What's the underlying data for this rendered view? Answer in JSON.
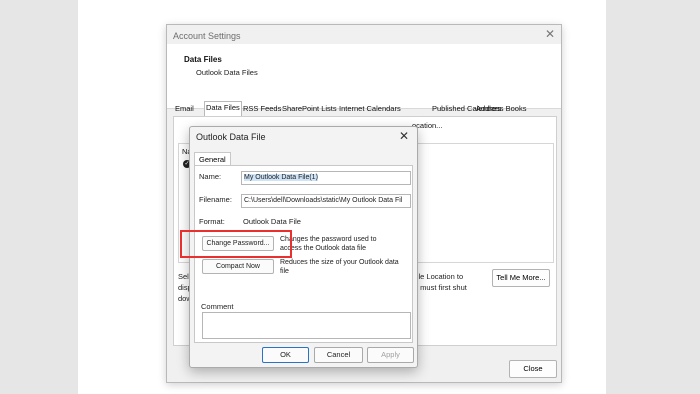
{
  "account_settings": {
    "title": "Account Settings",
    "header_title": "Data Files",
    "header_subtitle": "Outlook Data Files",
    "tabs": [
      "Email",
      "Data Files",
      "RSS Feeds",
      "SharePoint Lists",
      "Internet Calendars",
      "Published Calendars",
      "Address Books"
    ],
    "toolbar_fragment": "ocation...",
    "list_header_fragment": "Na",
    "left_note_fragment": "Sele\ndisp\ndow",
    "right_note_fragment": "n File Location to\nyou must first shut",
    "tell_me_more": "Tell Me More...",
    "close_button": "Close"
  },
  "outlook_data_file": {
    "title": "Outlook Data File",
    "tab_general": "General",
    "name_label": "Name:",
    "name_value": "My Outlook Data File(1)",
    "filename_label": "Filename:",
    "filename_value": "C:\\Users\\dell\\Downloads\\static\\My Outlook Data Fil",
    "format_label": "Format:",
    "format_value": "Outlook Data File",
    "change_password_button": "Change Password...",
    "change_password_desc": "Changes the password used to access the Outlook data file",
    "compact_now_button": "Compact Now",
    "compact_now_desc": "Reduces the size of your Outlook data file",
    "comment_label": "Comment",
    "ok_button": "OK",
    "cancel_button": "Cancel",
    "apply_button": "Apply"
  },
  "colors": {
    "highlight_box": "#e8312f",
    "selection": "#cfe4f7"
  }
}
